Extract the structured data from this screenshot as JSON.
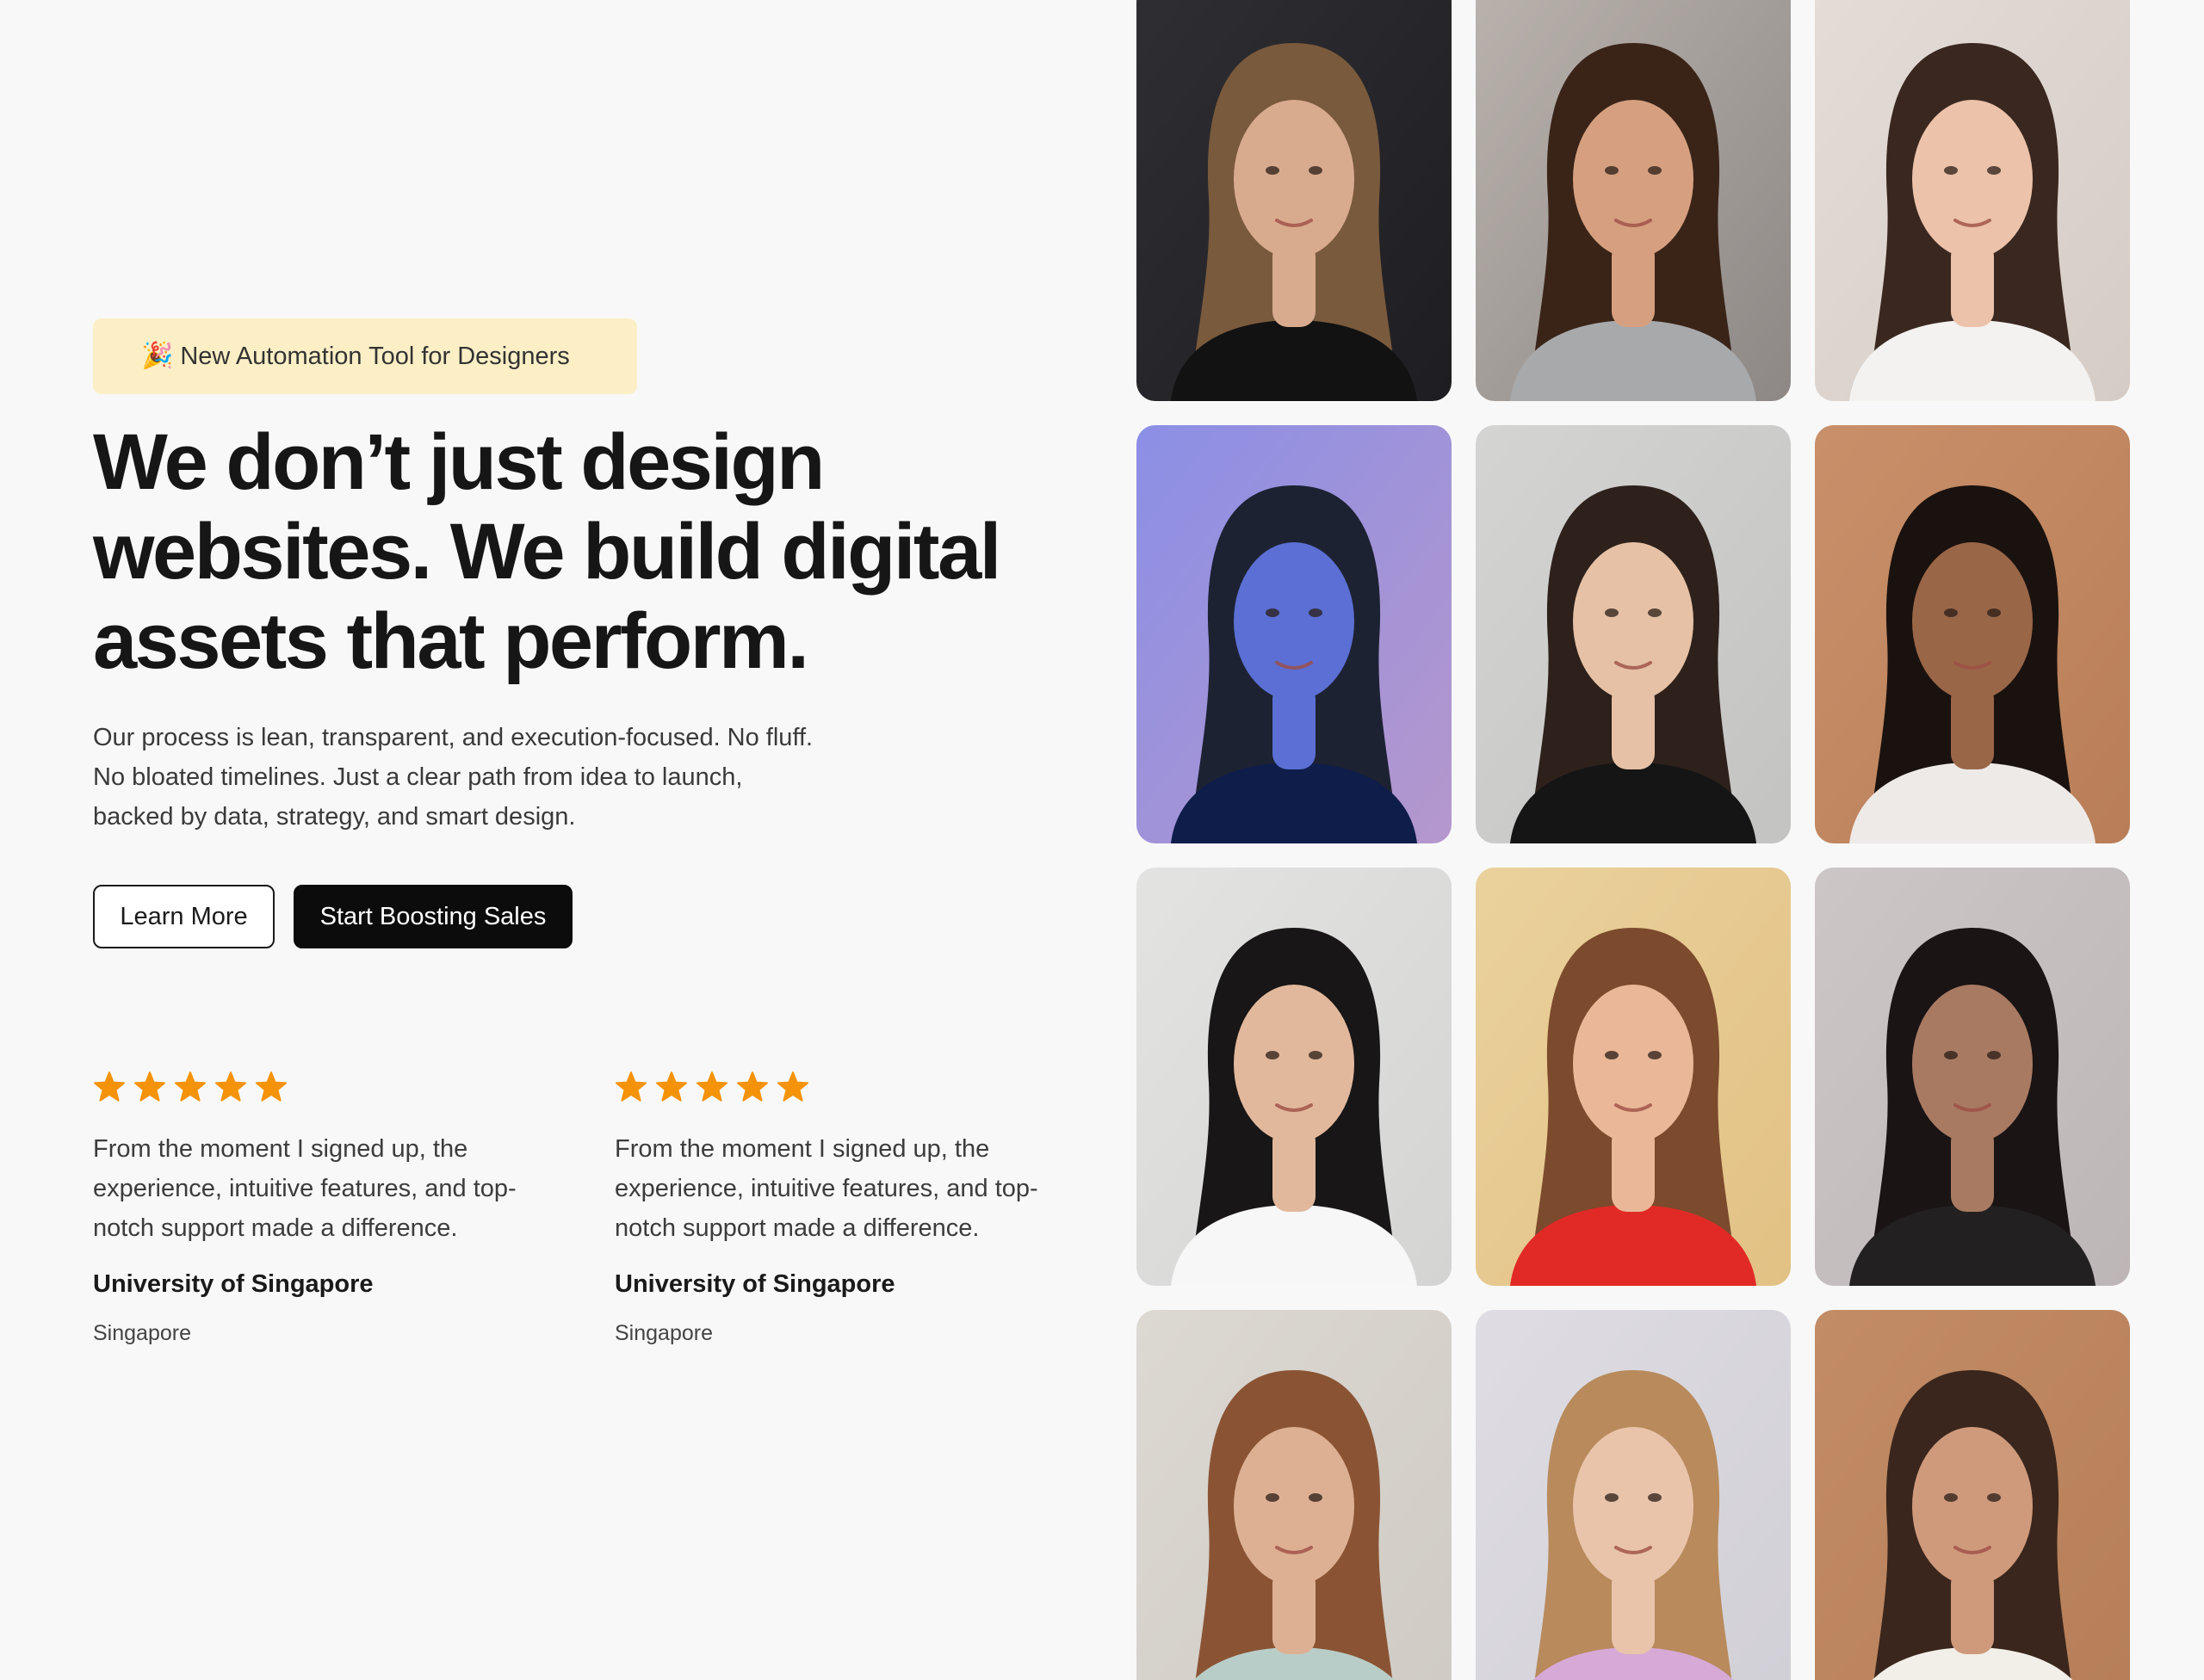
{
  "badge": {
    "icon": "party-popper-icon",
    "text": "New Automation Tool for Designers"
  },
  "hero": {
    "headline": "We don’t just design websites. We build digital assets that perform.",
    "subtext": "Our process is lean, transparent, and execution-focused. No fluff.\nNo bloated timelines. Just a clear path from idea to launch,\nbacked by data, strategy, and smart design."
  },
  "actions": {
    "learn_more": "Learn More",
    "start_boosting": "Start Boosting Sales"
  },
  "testimonials": [
    {
      "rating": 5,
      "quote": "From the moment I signed up, the\nexperience, intuitive features, and top-\nnotch support made a difference.",
      "organization": "University of Singapore",
      "location": "Singapore"
    },
    {
      "rating": 5,
      "quote": "From the moment I signed up, the\nexperience, intuitive features, and top-\nnotch support made a difference.",
      "organization": "University of Singapore",
      "location": "Singapore"
    }
  ],
  "colors": {
    "page_bg": "#f8f8f8",
    "badge_bg": "#fcefc6",
    "star": "#f4930a",
    "button_dark": "#0c0c0c"
  },
  "portraits": [
    {
      "bg": "#2f2f33",
      "bg2": "#1e1e22",
      "hair": "#7a5a3c",
      "skin": "#d9ab8e",
      "top": "#121212"
    },
    {
      "bg": "#b9b2ad",
      "bg2": "#8d8885",
      "hair": "#3a2418",
      "skin": "#d6a080",
      "top": "#a8a9ab"
    },
    {
      "bg": "#e4dcd7",
      "bg2": "#d6ccc6",
      "hair": "#3a2820",
      "skin": "#ecc2aa",
      "top": "#f4f2f0"
    },
    {
      "bg": "#8b8fe6",
      "bg2": "#b597cc",
      "hair": "#1d2233",
      "skin": "#5b6fd4",
      "top": "#0f1d4a"
    },
    {
      "bg": "#d4d4d2",
      "bg2": "#c3c3c1",
      "hair": "#2e211b",
      "skin": "#e6c1a6",
      "top": "#151515"
    },
    {
      "bg": "#c8906a",
      "bg2": "#b97e58",
      "hair": "#1a120e",
      "skin": "#9a6648",
      "top": "#eeeae8"
    },
    {
      "bg": "#e3e3e1",
      "bg2": "#d4d4d2",
      "hair": "#181616",
      "skin": "#e2b89c",
      "top": "#f7f7f7"
    },
    {
      "bg": "#ead19c",
      "bg2": "#e2c184",
      "hair": "#7c4a2c",
      "skin": "#eab898",
      "top": "#e12a26"
    },
    {
      "bg": "#ccc6c6",
      "bg2": "#bdb6b6",
      "hair": "#1a1414",
      "skin": "#a97a62",
      "top": "#222020"
    },
    {
      "bg": "#dcd8d2",
      "bg2": "#cfcac4",
      "hair": "#8a5434",
      "skin": "#deb093",
      "top": "#b9cdc8"
    },
    {
      "bg": "#dfdde3",
      "bg2": "#d1cfd6",
      "hair": "#b88a5c",
      "skin": "#e9c4aa",
      "top": "#d7a9d6"
    },
    {
      "bg": "#c28c66",
      "bg2": "#b57e58",
      "hair": "#3a261c",
      "skin": "#cf9a7c",
      "top": "#f2eee8"
    }
  ]
}
